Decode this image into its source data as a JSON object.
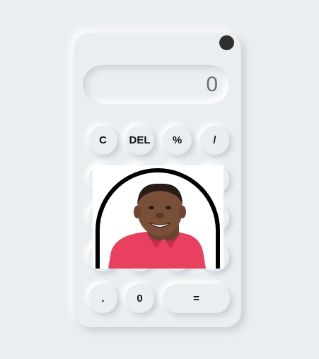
{
  "display": {
    "value": "0"
  },
  "buttons": {
    "clear": "C",
    "delete": "DEL",
    "percent": "%",
    "divide": "/",
    "decimal": ".",
    "zero": "0",
    "equals": "="
  },
  "colors": {
    "background": "#ebeef1",
    "toggle": "#2f2f2f",
    "display_text": "#6e6e6e",
    "shirt": "#e8405e"
  },
  "icons": {
    "theme_toggle": "circle-toggle-icon"
  }
}
